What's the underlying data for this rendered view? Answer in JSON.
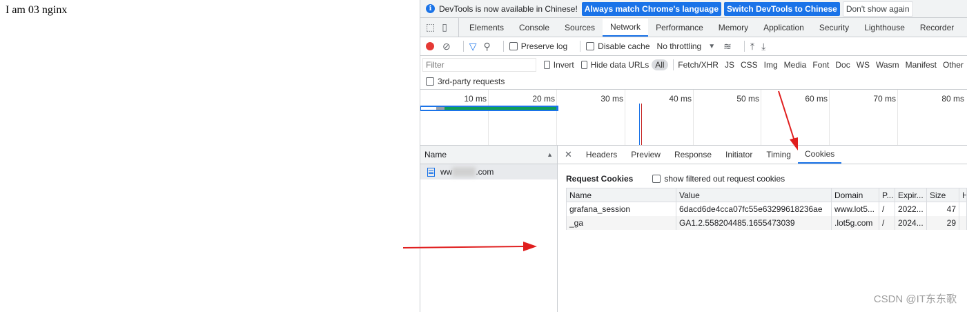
{
  "page": {
    "text": "I am 03 nginx"
  },
  "infobar": {
    "message": "DevTools is now available in Chinese!",
    "btn_match": "Always match Chrome's language",
    "btn_switch": "Switch DevTools to Chinese",
    "btn_dismiss": "Don't show again"
  },
  "tabs": [
    "Elements",
    "Console",
    "Sources",
    "Network",
    "Performance",
    "Memory",
    "Application",
    "Security",
    "Lighthouse",
    "Recorder"
  ],
  "network_toolbar": {
    "preserve_log": "Preserve log",
    "disable_cache": "Disable cache",
    "throttling": "No throttling"
  },
  "filter": {
    "placeholder": "Filter",
    "invert": "Invert",
    "hide_data_urls": "Hide data URLs",
    "types": [
      "All",
      "Fetch/XHR",
      "JS",
      "CSS",
      "Img",
      "Media",
      "Font",
      "Doc",
      "WS",
      "Wasm",
      "Manifest",
      "Other"
    ],
    "third_party": "3rd-party requests"
  },
  "timeline": {
    "ticks": [
      "10 ms",
      "20 ms",
      "30 ms",
      "40 ms",
      "50 ms",
      "60 ms",
      "70 ms",
      "80 ms"
    ]
  },
  "requests": {
    "header": "Name",
    "items": [
      {
        "prefix": "ww",
        "suffix": ".com"
      }
    ]
  },
  "detail_tabs": [
    "Headers",
    "Preview",
    "Response",
    "Initiator",
    "Timing",
    "Cookies"
  ],
  "cookies": {
    "title": "Request Cookies",
    "show_filtered": "show filtered out request cookies",
    "columns": [
      "Name",
      "Value",
      "Domain",
      "P...",
      "Expir...",
      "Size",
      "H"
    ],
    "rows": [
      [
        "grafana_session",
        "6dacd6de4cca07fc55e63299618236ae",
        "www.lot5...",
        "/",
        "2022...",
        "47"
      ],
      [
        "_ga",
        "GA1.2.558204485.1655473039",
        ".lot5g.com",
        "/",
        "2024...",
        "29"
      ]
    ]
  },
  "watermark": "CSDN @IT东东歌"
}
